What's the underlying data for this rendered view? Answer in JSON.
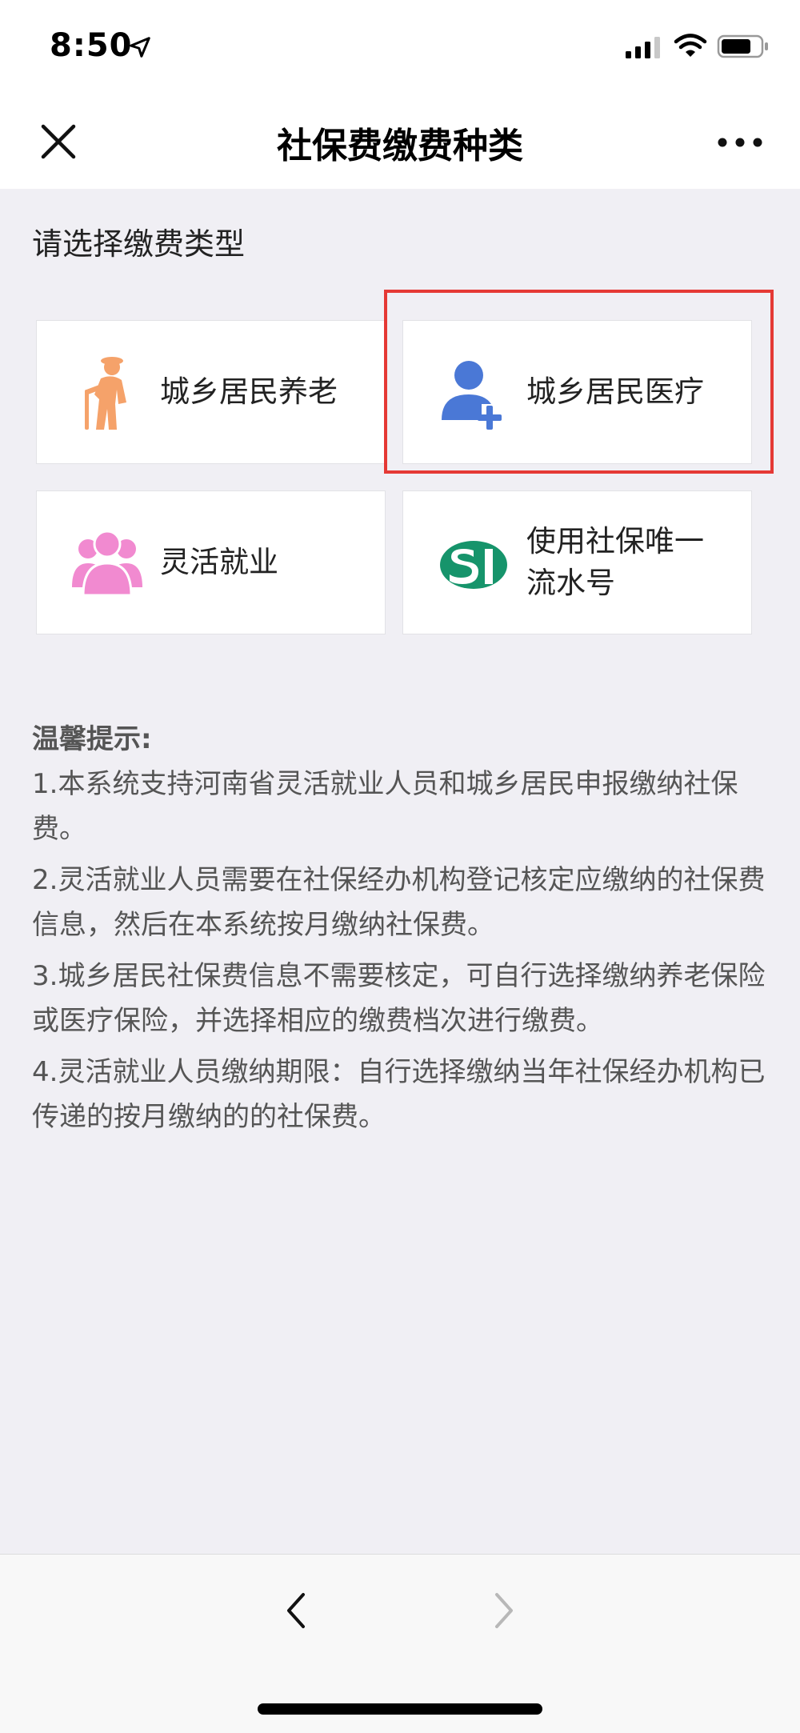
{
  "status_bar": {
    "time": "8:50",
    "icons": [
      "location-arrow-icon",
      "cellular-signal-icon",
      "wifi-icon",
      "battery-icon"
    ]
  },
  "header": {
    "title": "社保费缴费种类",
    "close_icon": "close-icon",
    "more_icon": "more-icon"
  },
  "main": {
    "section_label": "请选择缴费类型",
    "cards": [
      {
        "label": "城乡居民养老",
        "icon": "elderly-person-icon",
        "icon_color": "#f5a26a"
      },
      {
        "label": "城乡居民医疗",
        "icon": "user-add-icon",
        "icon_color": "#4a78d6",
        "highlighted": true
      },
      {
        "label": "灵活就业",
        "icon": "users-group-icon",
        "icon_color": "#f18ad0"
      },
      {
        "label": "使用社保唯一流水号",
        "label_lines": [
          "使用社保唯一",
          "流水号"
        ],
        "icon": "si-logo-icon",
        "icon_color": "#16946b"
      }
    ],
    "highlight_color": "#e53935"
  },
  "tips": {
    "title": "温馨提示:",
    "items": [
      "1.本系统支持河南省灵活就业人员和城乡居民申报缴纳社保费。",
      "2.灵活就业人员需要在社保经办机构登记核定应缴纳的社保费信息，然后在本系统按月缴纳社保费。",
      "3.城乡居民社保费信息不需要核定，可自行选择缴纳养老保险或医疗保险，并选择相应的缴费档次进行缴费。",
      "4.灵活就业人员缴纳期限：自行选择缴纳当年社保经办机构已传递的按月缴纳的的社保费。"
    ]
  },
  "bottom_bar": {
    "back_icon": "chevron-left-icon",
    "forward_icon": "chevron-right-icon"
  }
}
